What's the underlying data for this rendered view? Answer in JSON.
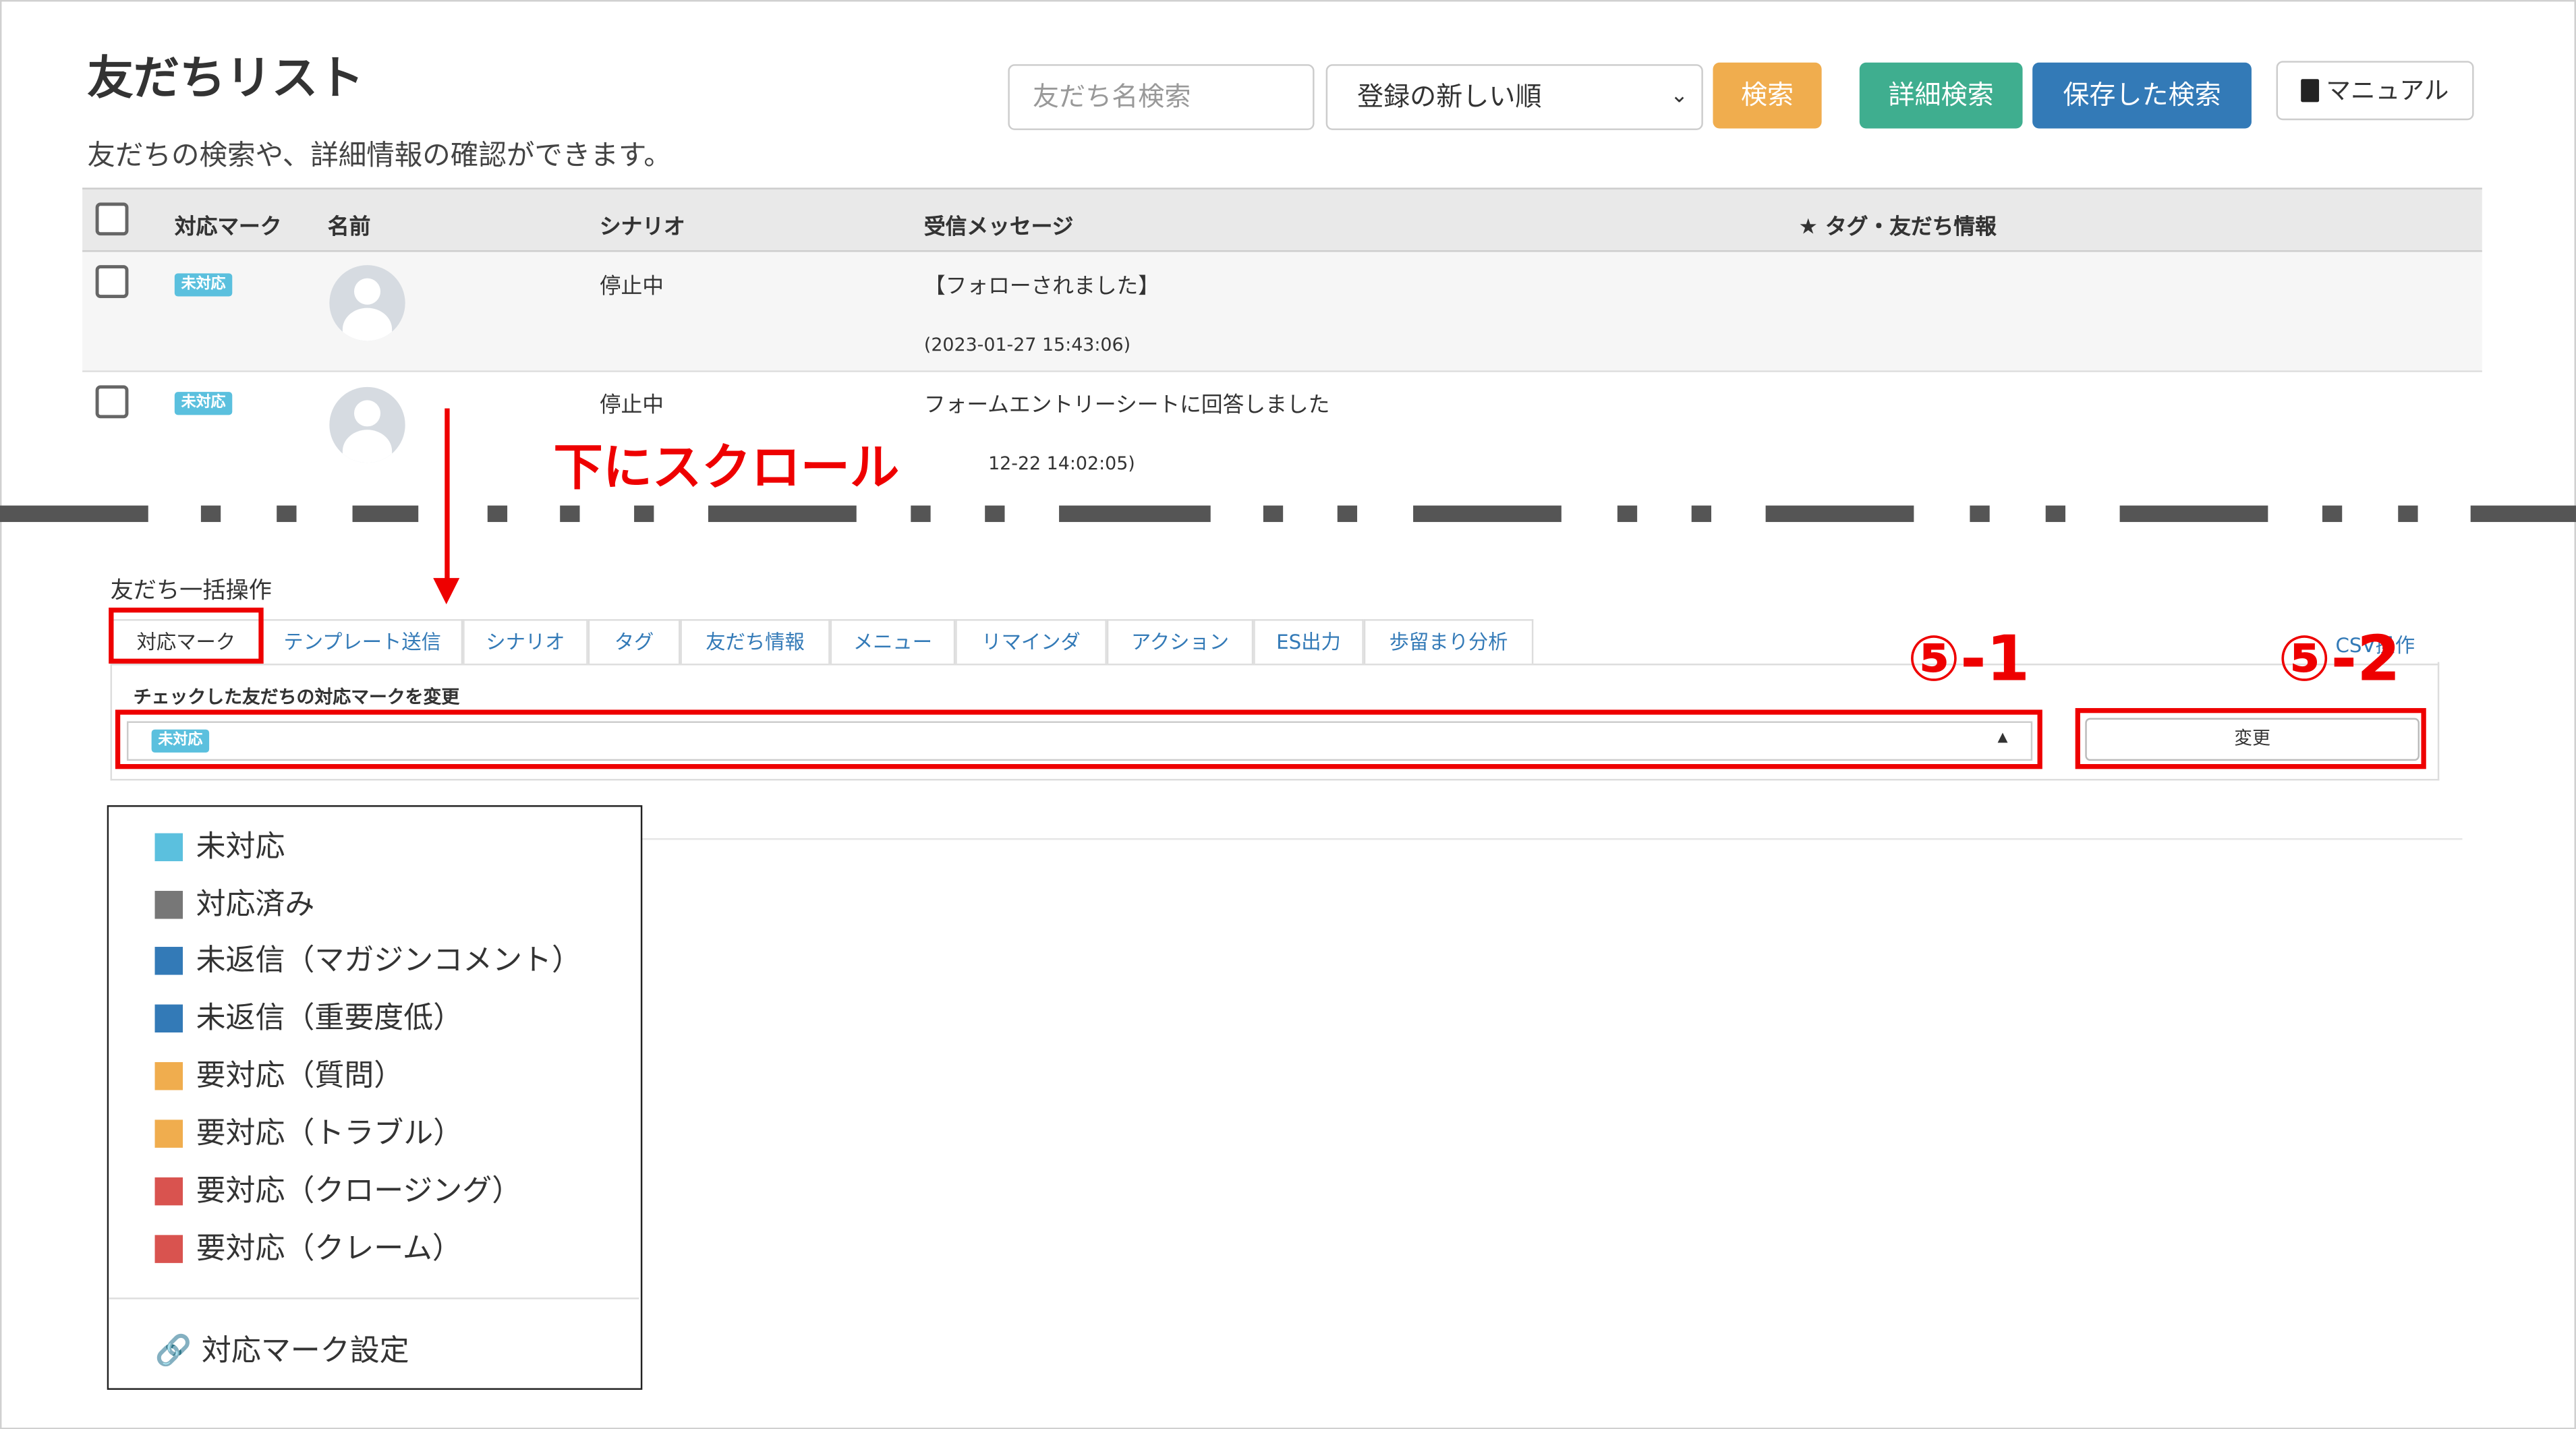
{
  "header": {
    "title": "友だちリスト",
    "subtitle": "友だちの検索や、詳細情報の確認ができます。",
    "search_placeholder": "友だち名検索",
    "sort_selected": "登録の新しい順",
    "search_button": "検索",
    "advanced_search_button": "詳細検索",
    "saved_search_button": "保存した検索",
    "manual_button": "マニュアル"
  },
  "table": {
    "columns": [
      "対応マーク",
      "名前",
      "シナリオ",
      "受信メッセージ",
      "★ タグ・友だち情報"
    ],
    "rows": [
      {
        "mark": "未対応",
        "scenario": "停止中",
        "message": "【フォローされました】",
        "timestamp": "(2023-01-27 15:43:06)"
      },
      {
        "mark": "未対応",
        "scenario": "停止中",
        "message": "フォームエントリーシートに回答しました",
        "timestamp": "12-22 14:02:05)"
      }
    ]
  },
  "annotation": {
    "scroll_text": "下にスクロール",
    "label_1": "⑤-1",
    "label_2": "⑤-2"
  },
  "bulk": {
    "title": "友だち一括操作",
    "tabs": [
      "対応マーク",
      "テンプレート送信",
      "シナリオ",
      "タグ",
      "友だち情報",
      "メニュー",
      "リマインダ",
      "アクション",
      "ES出力",
      "歩留まり分析"
    ],
    "csv_tab": "CSV操作",
    "panel_label": "チェックした友だちの対応マークを変更",
    "selected_mark": "未対応",
    "change_button": "変更"
  },
  "dropdown": {
    "options": [
      {
        "label": "未対応",
        "color": "#5bc0de"
      },
      {
        "label": "対応済み",
        "color": "#777777"
      },
      {
        "label": "未返信（マガジンコメント）",
        "color": "#337ab7"
      },
      {
        "label": "未返信（重要度低）",
        "color": "#337ab7"
      },
      {
        "label": "要対応（質問）",
        "color": "#f0ad4e"
      },
      {
        "label": "要対応（トラブル）",
        "color": "#f0ad4e"
      },
      {
        "label": "要対応（クロージング）",
        "color": "#d9534f"
      },
      {
        "label": "要対応（クレーム）",
        "color": "#d9534f"
      }
    ],
    "settings_link": "対応マーク設定"
  },
  "colors": {
    "annotation": "#e00000",
    "badge": "#5bc0de"
  },
  "icons": {
    "manual": "book-icon",
    "settings_link": "link-icon"
  }
}
